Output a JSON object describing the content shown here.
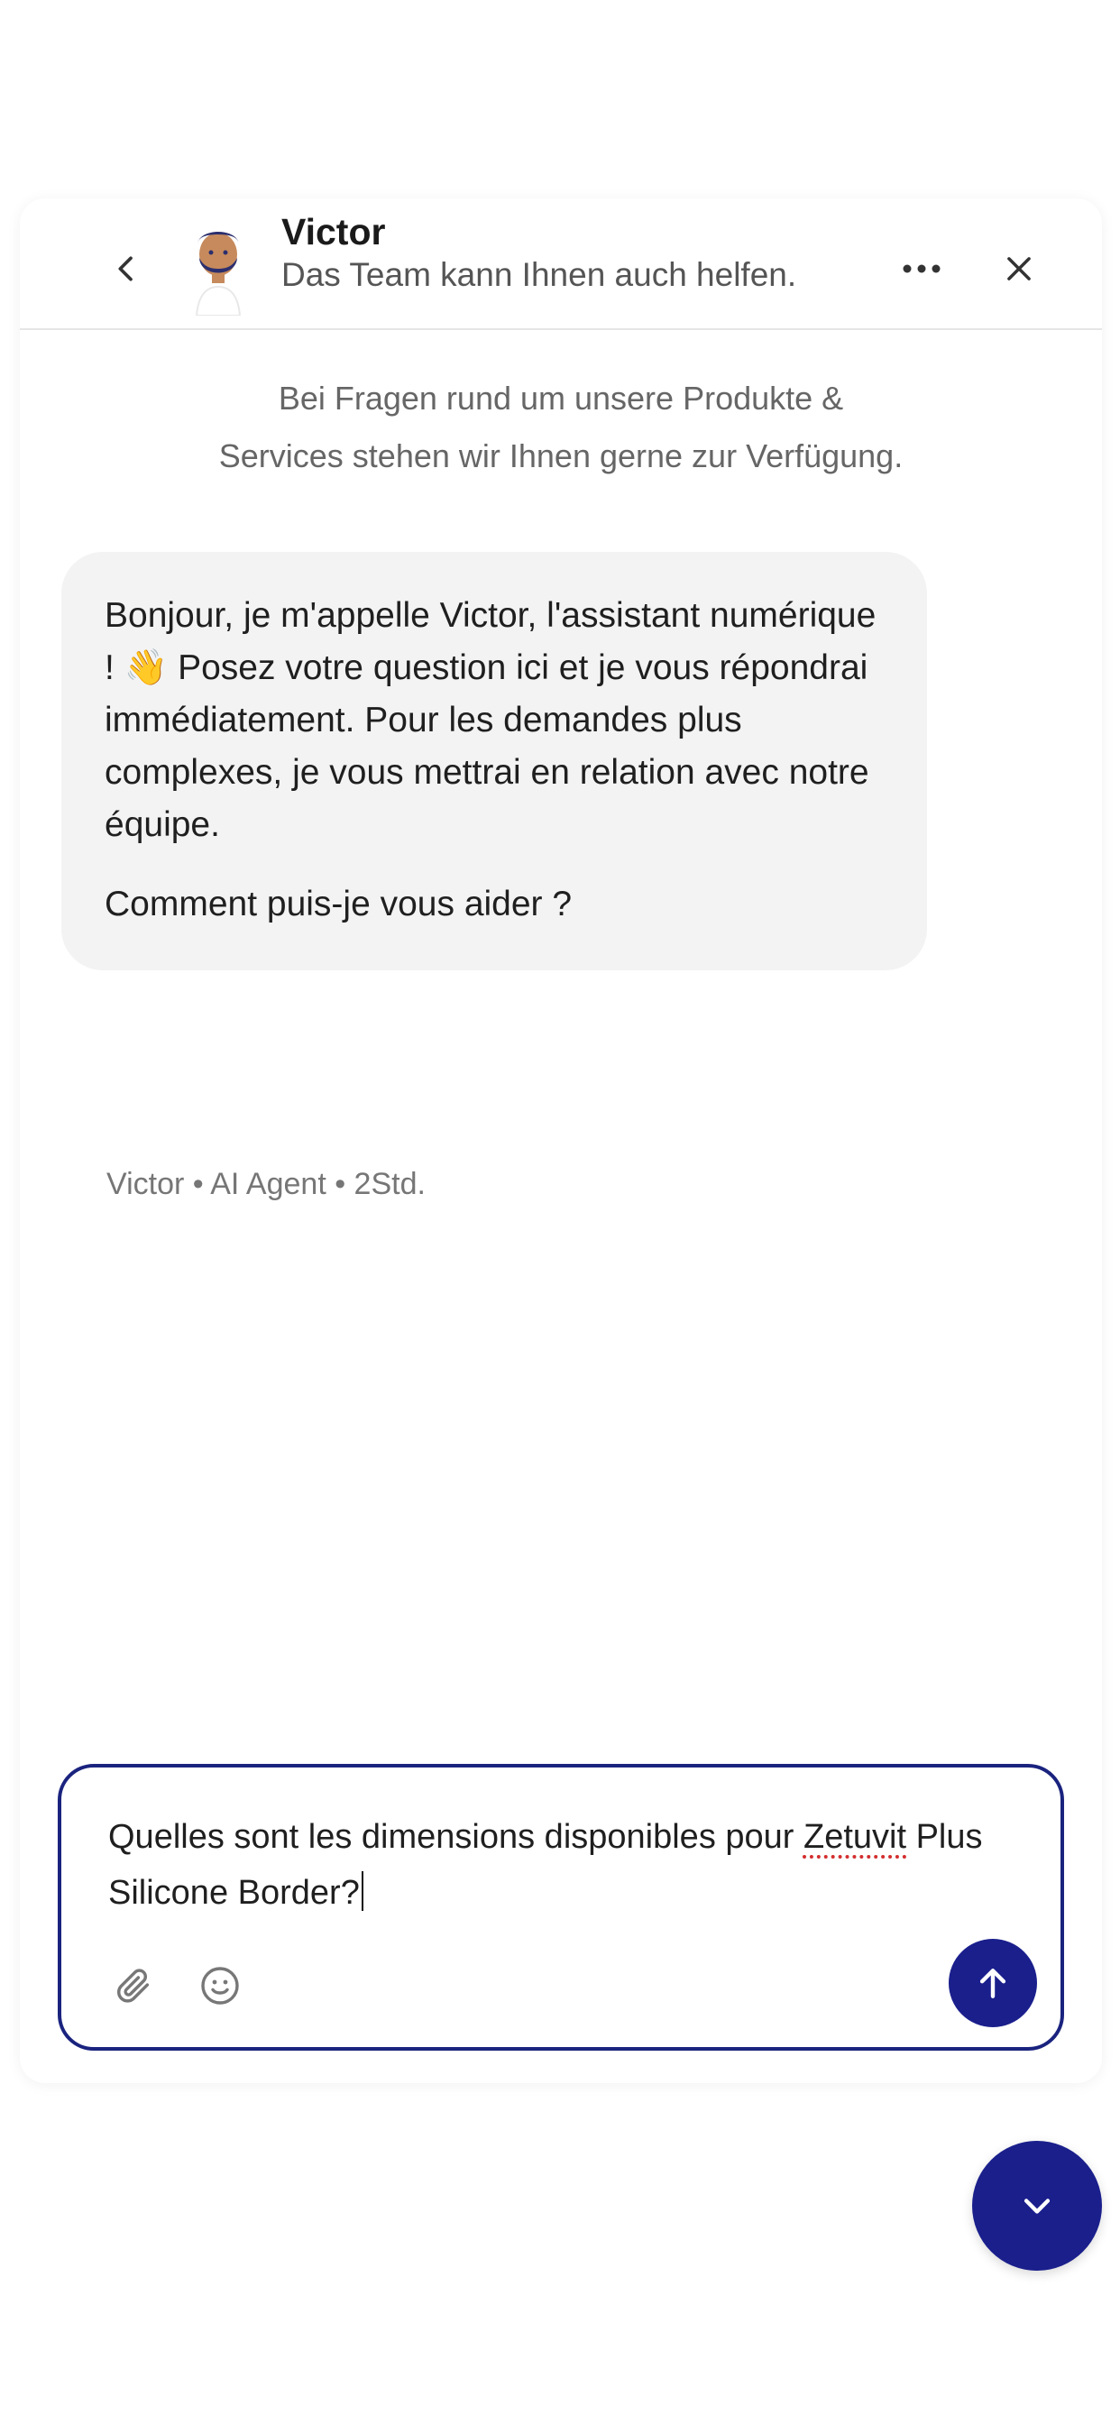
{
  "header": {
    "agent_name": "Victor",
    "subtitle": "Das Team kann Ihnen auch helfen.",
    "icons": {
      "back": "chevron-left-icon",
      "more": "more-horizontal-icon",
      "close": "close-icon"
    }
  },
  "intro": {
    "line1": "Bei Fragen rund um unsere Produkte &",
    "line2": "Services stehen wir Ihnen gerne zur Verfügung."
  },
  "message": {
    "paragraph1_before_emoji": "Bonjour, je m'appelle Victor, l'assistant numérique ! ",
    "emoji": "👋",
    "paragraph1_after_emoji": " Posez votre question ici et je vous répondrai immédiatement. Pour les demandes plus complexes, je vous mettrai en relation avec notre équipe.",
    "paragraph2": "Comment puis-je vous aider ?",
    "meta": "Victor • AI Agent • 2Std."
  },
  "composer": {
    "text_before_flagged": "Quelles sont les dimensions disponibles pour ",
    "flagged_word": "Zetuvit",
    "text_after_flagged": " Plus Silicone Border?",
    "icons": {
      "attach": "paperclip-icon",
      "emoji": "smiley-icon",
      "send": "arrow-up-icon"
    }
  },
  "launcher": {
    "icon": "chevron-down-icon"
  },
  "colors": {
    "accent": "#1a1f8c",
    "composer_border": "#1a237e",
    "bubble_bg": "#f3f3f3",
    "spellcheck": "#d32f2f"
  }
}
